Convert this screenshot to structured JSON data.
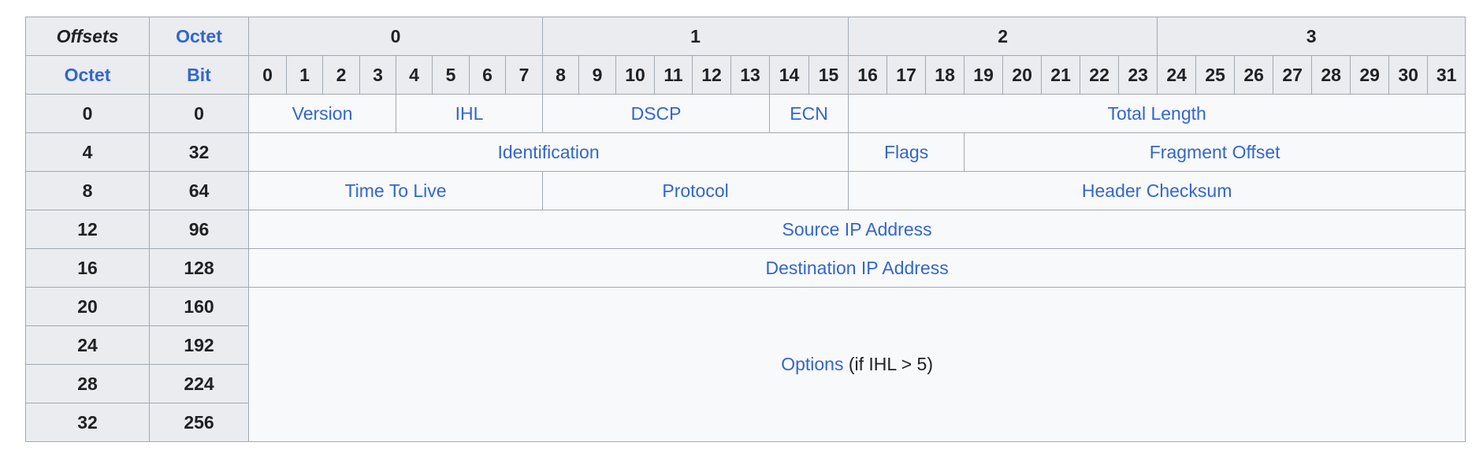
{
  "header": {
    "offsets_label": "Offsets",
    "octet_label": "Octet",
    "octet_col_label": "Octet",
    "bit_label": "Bit",
    "octet_numbers": [
      "0",
      "1",
      "2",
      "3"
    ],
    "bit_numbers": [
      "0",
      "1",
      "2",
      "3",
      "4",
      "5",
      "6",
      "7",
      "8",
      "9",
      "10",
      "11",
      "12",
      "13",
      "14",
      "15",
      "16",
      "17",
      "18",
      "19",
      "20",
      "21",
      "22",
      "23",
      "24",
      "25",
      "26",
      "27",
      "28",
      "29",
      "30",
      "31"
    ]
  },
  "rows": [
    {
      "octet": "0",
      "bit": "0"
    },
    {
      "octet": "4",
      "bit": "32"
    },
    {
      "octet": "8",
      "bit": "64"
    },
    {
      "octet": "12",
      "bit": "96"
    },
    {
      "octet": "16",
      "bit": "128"
    },
    {
      "octet": "20",
      "bit": "160"
    },
    {
      "octet": "24",
      "bit": "192"
    },
    {
      "octet": "28",
      "bit": "224"
    },
    {
      "octet": "32",
      "bit": "256"
    }
  ],
  "fields": {
    "version": "Version",
    "ihl": "IHL",
    "dscp": "DSCP",
    "ecn": "ECN",
    "total_length": "Total Length",
    "identification": "Identification",
    "flags": "Flags",
    "fragment_offset": "Fragment Offset",
    "ttl": "Time To Live",
    "protocol": "Protocol",
    "header_checksum": "Header Checksum",
    "source_ip": "Source IP Address",
    "destination_ip": "Destination IP Address",
    "options": "Options",
    "options_note": " (if IHL > 5)"
  },
  "colors": {
    "link": "#3366cc",
    "header_bg": "#eaecf0",
    "cell_bg": "#f8f9fa",
    "border": "#a2a9b1",
    "text": "#202122"
  }
}
